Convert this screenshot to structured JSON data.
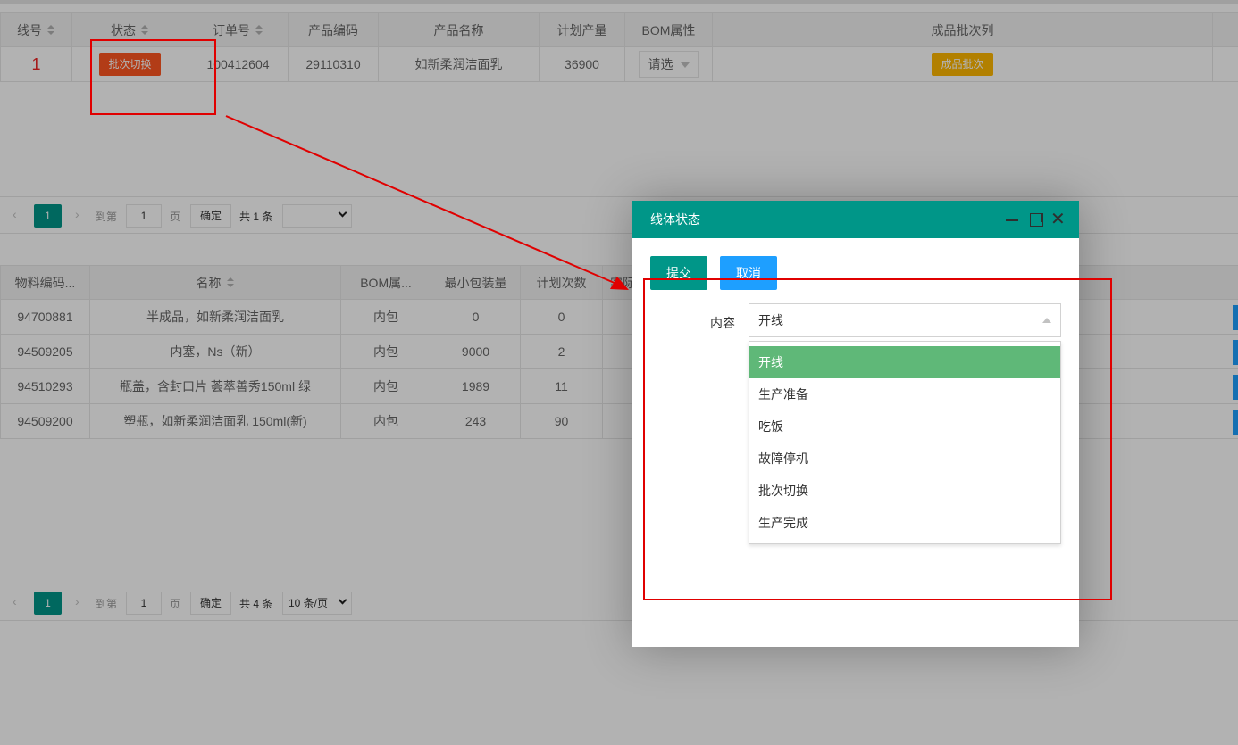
{
  "top_table": {
    "headers": [
      "线号",
      "状态",
      "订单号",
      "产品编码",
      "产品名称",
      "计划产量",
      "BOM属性",
      "成品批次列",
      ""
    ],
    "row": {
      "line_no": "1",
      "status_btn": "批次切换",
      "order_no": "100412604",
      "product_code": "29110310",
      "product_name": "如新柔润洁面乳",
      "plan_qty": "36900",
      "bom_select": "请选",
      "batch_btn": "成品批次"
    }
  },
  "pager1": {
    "prev": "‹",
    "current": "1",
    "next": "›",
    "goto": "到第",
    "input": "1",
    "page": "页",
    "ok": "确定",
    "total": "共 1 条",
    "limit": ""
  },
  "bottom_table": {
    "headers": [
      "物料编码...",
      "名称",
      "BOM属...",
      "最小包装量",
      "计划次数",
      "实际"
    ],
    "rows": [
      {
        "code": "94700881",
        "name": "半成品，如新柔润洁面乳",
        "bom": "内包",
        "min_pack": "0",
        "plan_times": "0"
      },
      {
        "code": "94509205",
        "name": "内塞，Ns（新）",
        "bom": "内包",
        "min_pack": "9000",
        "plan_times": "2"
      },
      {
        "code": "94510293",
        "name": "瓶盖，含封口片 荟萃善秀150ml 绿",
        "bom": "内包",
        "min_pack": "1989",
        "plan_times": "11"
      },
      {
        "code": "94509200",
        "name": "塑瓶，如新柔润洁面乳 150ml(新)",
        "bom": "内包",
        "min_pack": "243",
        "plan_times": "90"
      }
    ]
  },
  "pager2": {
    "prev": "‹",
    "current": "1",
    "next": "›",
    "goto": "到第",
    "input": "1",
    "page": "页",
    "ok": "确定",
    "total": "共 4 条",
    "limit": "10 条/页"
  },
  "dialog": {
    "title": "线体状态",
    "submit": "提交",
    "cancel": "取消",
    "field_label": "内容",
    "selected_value": "开线",
    "options": [
      "开线",
      "生产准备",
      "吃饭",
      "故障停机",
      "批次切换",
      "生产完成"
    ],
    "close_glyph": "✕"
  },
  "colors": {
    "teal": "#009688",
    "orange": "#FF5722",
    "yellow": "#FFB800",
    "blue": "#1E9FFF",
    "green": "#5FB878",
    "annotation_red": "#e00000"
  }
}
